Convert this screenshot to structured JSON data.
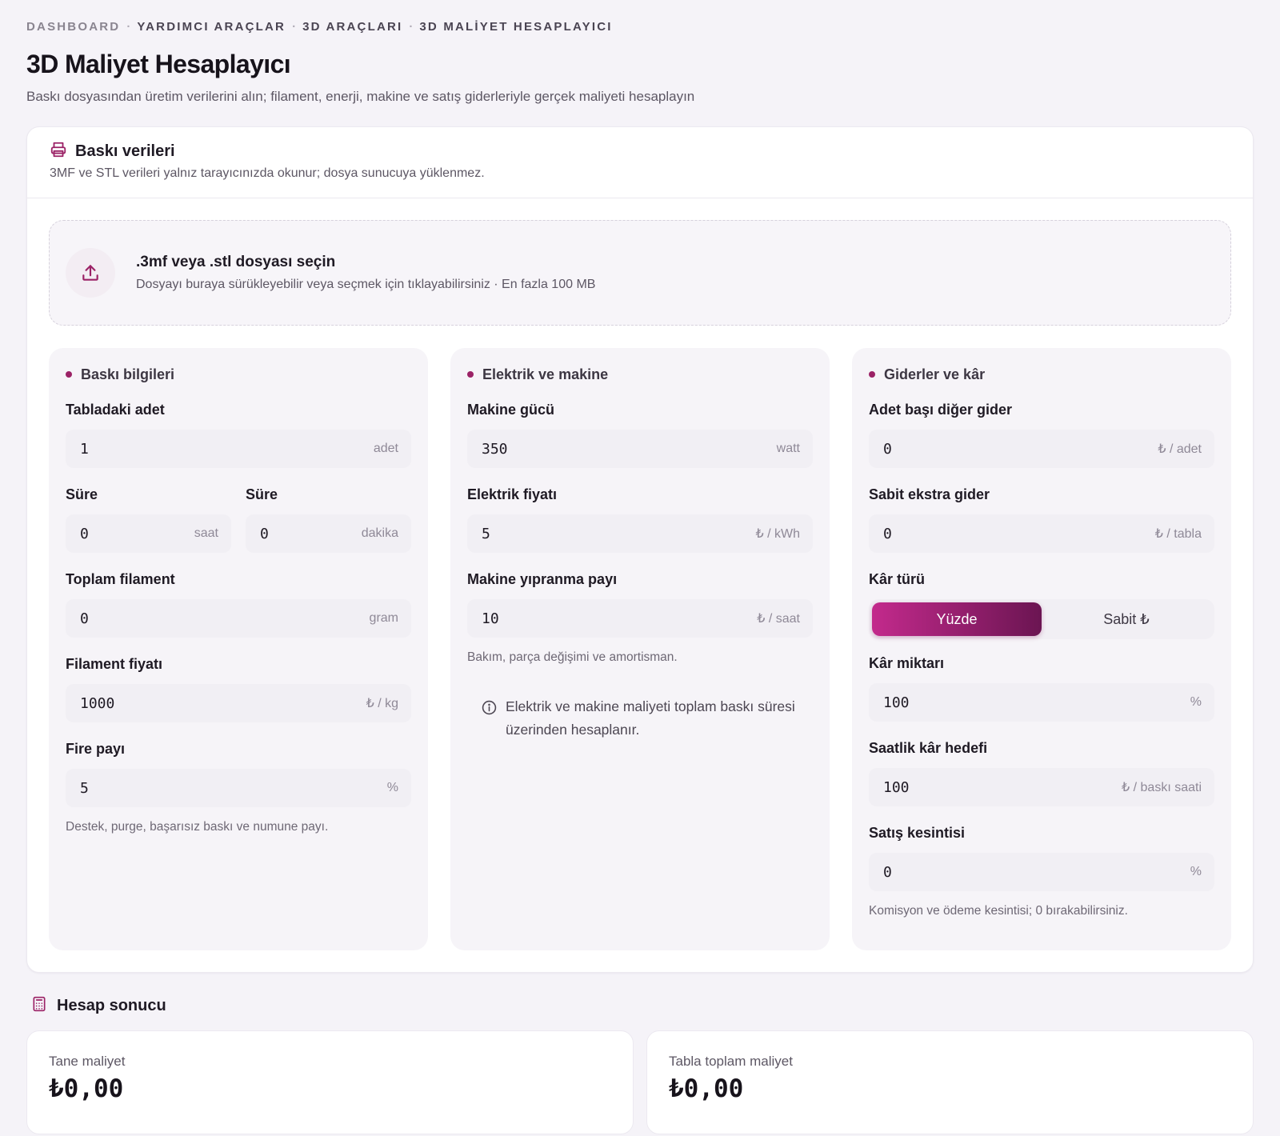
{
  "breadcrumb": [
    "DASHBOARD",
    "YARDIMCI ARAÇLAR",
    "3D ARAÇLARI",
    "3D MALİYET HESAPLAYICI"
  ],
  "breadcrumb_sep": "·",
  "page": {
    "title": "3D Maliyet Hesaplayıcı",
    "subtitle": "Baskı dosyasından üretim verilerini alın; filament, enerji, makine ve satış giderleriyle gerçek maliyeti hesaplayın"
  },
  "print_card": {
    "title": "Baskı verileri",
    "desc": "3MF ve STL verileri yalnız tarayıcınızda okunur; dosya sunucuya yüklenmez.",
    "icon": "printer-icon"
  },
  "dropzone": {
    "title": ".3mf veya .stl dosyası seçin",
    "desc": "Dosyayı buraya sürükleyebilir veya seçmek için tıklayabilirsiniz · En fazla 100 MB",
    "icon": "upload-icon"
  },
  "print_info": {
    "title": "Baskı bilgileri",
    "qty": {
      "label": "Tabladaki adet",
      "value": "1",
      "unit": "adet"
    },
    "hours": {
      "label": "Süre",
      "value": "0",
      "unit": "saat"
    },
    "minutes": {
      "label": "Süre",
      "value": "0",
      "unit": "dakika"
    },
    "filament": {
      "label": "Toplam filament",
      "value": "0",
      "unit": "gram"
    },
    "filament_price": {
      "label": "Filament fiyatı",
      "value": "1000",
      "unit": "₺ / kg"
    },
    "waste": {
      "label": "Fire payı",
      "value": "5",
      "unit": "%"
    },
    "hint": "Destek, purge, başarısız baskı ve numune payı."
  },
  "electric": {
    "title": "Elektrik ve makine",
    "power": {
      "label": "Makine gücü",
      "value": "350",
      "unit": "watt"
    },
    "price": {
      "label": "Elektrik fiyatı",
      "value": "5",
      "unit": "₺ / kWh"
    },
    "wear": {
      "label": "Makine yıpranma payı",
      "value": "10",
      "unit": "₺ / saat"
    },
    "hint": "Bakım, parça değişimi ve amortisman.",
    "info": "Elektrik ve makine maliyeti toplam baskı süresi üzerinden hesaplanır."
  },
  "expenses": {
    "title": "Giderler ve kâr",
    "other": {
      "label": "Adet başı diğer gider",
      "value": "0",
      "unit": "₺ / adet"
    },
    "fixed": {
      "label": "Sabit ekstra gider",
      "value": "0",
      "unit": "₺ / tabla"
    },
    "profit_type": {
      "label": "Kâr türü",
      "option_percent": "Yüzde",
      "option_fixed": "Sabit ₺",
      "selected": "Yüzde"
    },
    "profit_amount": {
      "label": "Kâr miktarı",
      "value": "100",
      "unit": "%"
    },
    "hourly": {
      "label": "Saatlik kâr hedefi",
      "value": "100",
      "unit": "₺ / baskı saati"
    },
    "sales_cut": {
      "label": "Satış kesintisi",
      "value": "0",
      "unit": "%"
    },
    "hint": "Komisyon ve ödeme kesintisi; 0 bırakabilirsiniz."
  },
  "result": {
    "title": "Hesap sonucu",
    "unit_cost": {
      "label": "Tane maliyet",
      "value": "₺0,00"
    },
    "total_cost": {
      "label": "Tabla toplam maliyet",
      "value": "₺0,00"
    }
  },
  "colors": {
    "accent": "#9b2266",
    "accent_gradient_start": "#c32a8c",
    "accent_gradient_end": "#6b1552"
  }
}
